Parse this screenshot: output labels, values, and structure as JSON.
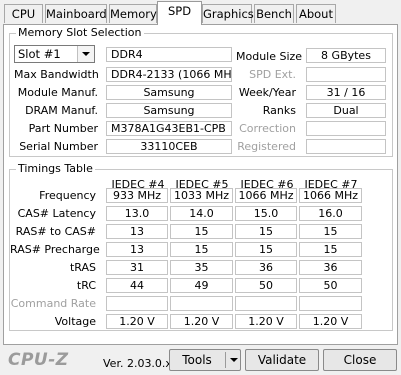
{
  "tabs": [
    "CPU",
    "Mainboard",
    "Memory",
    "SPD",
    "Graphics",
    "Bench",
    "About"
  ],
  "slot_group_title": "Memory Slot Selection",
  "slot": {
    "selected": "Slot #1",
    "type": "DDR4",
    "max_bandwidth_label": "Max Bandwidth",
    "max_bandwidth": "DDR4-2133 (1066 MHz)",
    "module_manuf_label": "Module Manuf.",
    "module_manuf": "Samsung",
    "dram_manuf_label": "DRAM Manuf.",
    "dram_manuf": "Samsung",
    "part_number_label": "Part Number",
    "part_number": "M378A1G43EB1-CPB",
    "serial_number_label": "Serial Number",
    "serial_number": "33110CEB",
    "module_size_label": "Module Size",
    "module_size": "8 GBytes",
    "spd_ext_label": "SPD Ext.",
    "spd_ext": "",
    "week_year_label": "Week/Year",
    "week_year": "31 / 16",
    "ranks_label": "Ranks",
    "ranks": "Dual",
    "correction_label": "Correction",
    "correction": "",
    "registered_label": "Registered",
    "registered": ""
  },
  "timings_group_title": "Timings Table",
  "timings": {
    "columns": [
      "JEDEC #4",
      "JEDEC #5",
      "JEDEC #6",
      "JEDEC #7"
    ],
    "rows": [
      {
        "label": "Frequency",
        "values": [
          "933 MHz",
          "1033 MHz",
          "1066 MHz",
          "1066 MHz"
        ]
      },
      {
        "label": "CAS# Latency",
        "values": [
          "13.0",
          "14.0",
          "15.0",
          "16.0"
        ]
      },
      {
        "label": "RAS# to CAS#",
        "values": [
          "13",
          "15",
          "15",
          "15"
        ]
      },
      {
        "label": "RAS# Precharge",
        "values": [
          "13",
          "15",
          "15",
          "15"
        ]
      },
      {
        "label": "tRAS",
        "values": [
          "31",
          "35",
          "36",
          "36"
        ]
      },
      {
        "label": "tRC",
        "values": [
          "44",
          "49",
          "50",
          "50"
        ]
      },
      {
        "label": "Command Rate",
        "values": [
          "",
          "",
          "",
          ""
        ]
      },
      {
        "label": "Voltage",
        "values": [
          "1.20 V",
          "1.20 V",
          "1.20 V",
          "1.20 V"
        ]
      }
    ]
  },
  "footer": {
    "logo": "CPU-Z",
    "version": "Ver. 2.03.0.x64",
    "tools_label": "Tools",
    "validate_label": "Validate",
    "close_label": "Close"
  }
}
